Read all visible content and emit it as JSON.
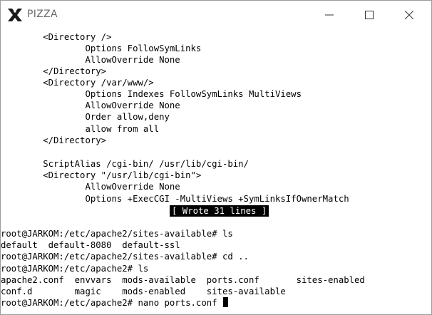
{
  "window": {
    "title": "PIZZA",
    "icon": "x-window-icon",
    "controls": [
      "minimize-icon",
      "maximize-icon",
      "close-icon"
    ]
  },
  "terminal": {
    "editor_lines": [
      "        <Directory />",
      "                Options FollowSymLinks",
      "                AllowOverride None",
      "        </Directory>",
      "        <Directory /var/www/>",
      "                Options Indexes FollowSymLinks MultiViews",
      "                AllowOverride None",
      "                Order allow,deny",
      "                allow from all",
      "        </Directory>",
      "",
      "        ScriptAlias /cgi-bin/ /usr/lib/cgi-bin/",
      "        <Directory \"/usr/lib/cgi-bin\">",
      "                AllowOverride None",
      "                Options +ExecCGI -MultiViews +SymLinksIfOwnerMatch"
    ],
    "status_message": "[ Wrote 31 lines ]",
    "shell_lines": [
      "root@JARKOM:/etc/apache2/sites-available# ls",
      "default  default-8080  default-ssl",
      "root@JARKOM:/etc/apache2/sites-available# cd ..",
      "root@JARKOM:/etc/apache2# ls",
      "apache2.conf  envvars  mods-available  ports.conf       sites-enabled",
      "conf.d        magic    mods-enabled    sites-available"
    ],
    "prompt": "root@JARKOM:/etc/apache2# nano ports.conf "
  }
}
